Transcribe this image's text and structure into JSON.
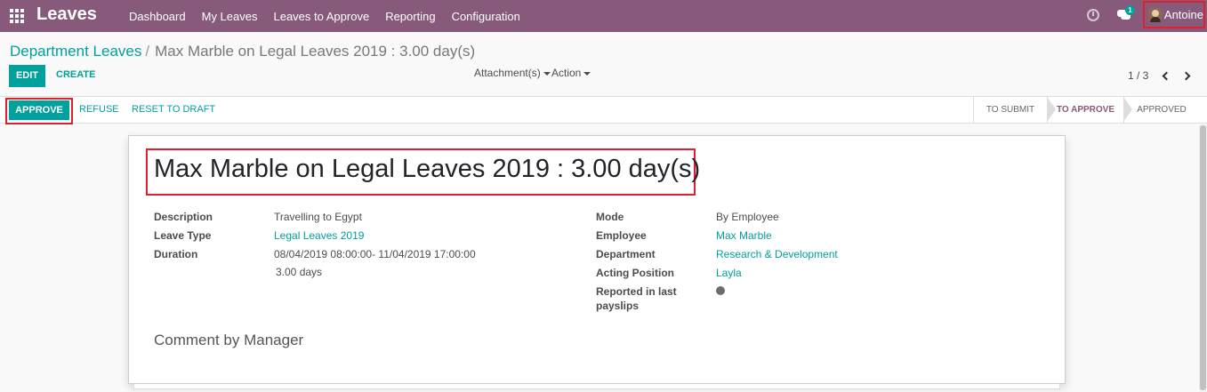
{
  "navbar": {
    "brand": "Leaves",
    "menu": [
      "Dashboard",
      "My Leaves",
      "Leaves to Approve",
      "Reporting",
      "Configuration"
    ],
    "chat_count": "1",
    "user_name": "Antoine"
  },
  "breadcrumb": {
    "parent": "Department Leaves",
    "separator": "/",
    "current": "Max Marble on Legal Leaves 2019 : 3.00 day(s)"
  },
  "toolbar": {
    "edit_label": "EDIT",
    "create_label": "CREATE",
    "attachments_label": "Attachment(s)",
    "action_label": "Action",
    "pager": "1 / 3"
  },
  "statusbar": {
    "approve_label": "APPROVE",
    "refuse_label": "REFUSE",
    "reset_label": "RESET TO DRAFT",
    "stages": [
      "TO SUBMIT",
      "TO APPROVE",
      "APPROVED"
    ],
    "active_stage": "TO APPROVE"
  },
  "form": {
    "title": "Max Marble on Legal Leaves 2019 : 3.00 day(s)",
    "left": {
      "description_label": "Description",
      "description_value": "Travelling to Egypt",
      "leave_type_label": "Leave Type",
      "leave_type_value": "Legal Leaves 2019",
      "duration_label": "Duration",
      "duration_dates": "08/04/2019 08:00:00- 11/04/2019 17:00:00",
      "duration_days": "3.00 days"
    },
    "right": {
      "mode_label": "Mode",
      "mode_value": "By Employee",
      "employee_label": "Employee",
      "employee_value": "Max Marble",
      "department_label": "Department",
      "department_value": "Research & Development",
      "acting_position_label": "Acting Position",
      "acting_position_value": "Layla",
      "reported_label_line1": "Reported in last",
      "reported_label_line2": "payslips"
    },
    "comment_title": "Comment by Manager"
  },
  "colors": {
    "brand": "#875a7b",
    "accent": "#00a09d",
    "highlight": "#e0202c"
  }
}
